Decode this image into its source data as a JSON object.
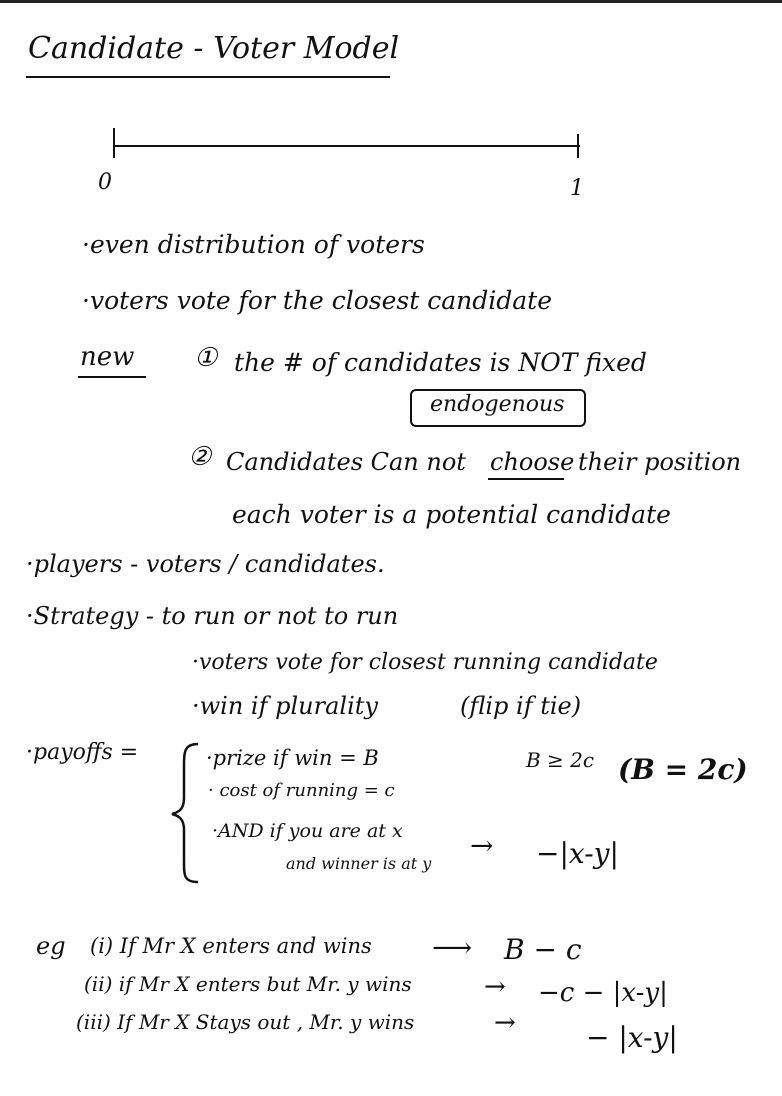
{
  "page": {
    "title": "Candidate - Voter Model",
    "axis": {
      "left_label": "0",
      "right_label": "1"
    },
    "bullets_top": [
      "·even distribution of voters",
      "·voters vote for the closest candidate"
    ],
    "new_block": {
      "label": "new",
      "item1_num": "①",
      "item1_text": "the # of candidates is NOT fixed",
      "item1_boxed": "endogenous",
      "item2_num": "②",
      "item2_pre": "Candidates Can not",
      "item2_underlined": "choose",
      "item2_post": "their position",
      "item2_line2": "each voter is a potential candidate"
    },
    "players": "·players  -  voters / candidates.",
    "strategy": {
      "label": "·Strategy  -  to run or not to run",
      "sub1": "·voters vote for closest running candidate",
      "sub2a": "·win if plurality",
      "sub2b": "(flip if tie)"
    },
    "payoffs": {
      "label": "·payoffs =",
      "prize": "·prize if win  = B",
      "cost": "· cost of running = c",
      "and1": "·AND  if you are at x",
      "and2": "and winner is at y",
      "arrow": "→",
      "and_result": "−|x-y|",
      "cond1": "B ≥ 2c",
      "cond2": "(B = 2c)"
    },
    "examples": {
      "eg": "eg",
      "e1": "(i) If Mr X  enters and wins",
      "e1_arrow": "⟶",
      "e1_result": "B − c",
      "e2": "(ii) if Mr X enters but Mr. y wins",
      "e2_arrow": "→",
      "e2_result": "−c − |x-y|",
      "e3": "(iii) If Mr X Stays out , Mr. y wins",
      "e3_arrow": "→",
      "e3_result": "− |x-y|"
    }
  }
}
